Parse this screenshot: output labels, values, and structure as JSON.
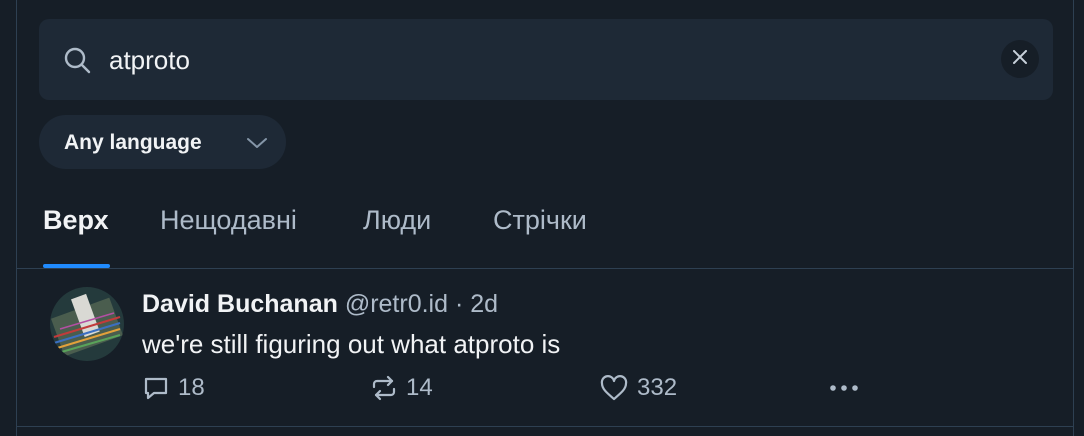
{
  "search": {
    "value": "atproto",
    "icon": "search-icon",
    "clear_icon": "close-icon"
  },
  "language_filter": {
    "label": "Any language",
    "icon": "chevron-down-icon"
  },
  "tabs": [
    {
      "label": "Верх",
      "active": true
    },
    {
      "label": "Нещодавні",
      "active": false
    },
    {
      "label": "Люди",
      "active": false
    },
    {
      "label": "Стрічки",
      "active": false
    }
  ],
  "post": {
    "author": "David Buchanan",
    "handle": "@retr0.id",
    "separator": "·",
    "time": "2d",
    "text": "we're still figuring out what atproto is",
    "replies": "18",
    "reposts": "14",
    "likes": "332"
  },
  "colors": {
    "background": "#161e27",
    "surface": "#1e2936",
    "accent": "#208bfe",
    "text": "#f1f3f5",
    "muted": "#aebbc9"
  }
}
